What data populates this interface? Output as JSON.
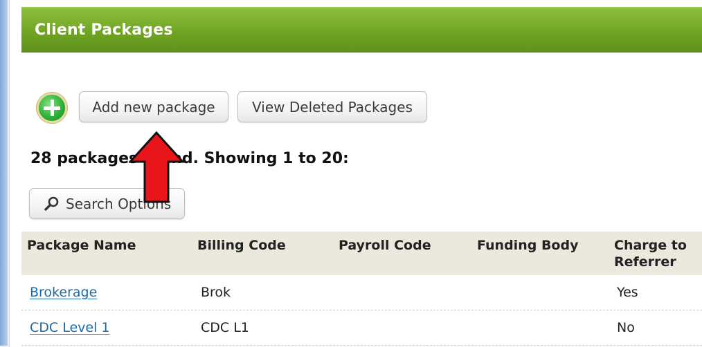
{
  "header": {
    "title": "Client Packages"
  },
  "toolbar": {
    "add_label": "Add new package",
    "deleted_label": "View Deleted Packages"
  },
  "summary": {
    "text": "28 packages found. Showing 1 to 20:"
  },
  "search": {
    "label": "Search Options",
    "icon": "magnifier-icon"
  },
  "table": {
    "columns": [
      "Package Name",
      "Billing Code",
      "Payroll Code",
      "Funding Body",
      "Charge to Referrer"
    ],
    "rows": [
      {
        "name": "Brokerage",
        "billing": "Brok",
        "payroll": "",
        "funding": "",
        "charge": "Yes"
      },
      {
        "name": "CDC Level 1",
        "billing": "CDC L1",
        "payroll": "",
        "funding": "",
        "charge": "No"
      }
    ]
  },
  "colors": {
    "header_green": "#6fa423",
    "link_blue": "#1f6aa5",
    "table_header_bg": "#ebe9de",
    "annotation_arrow": "#e8161b"
  }
}
